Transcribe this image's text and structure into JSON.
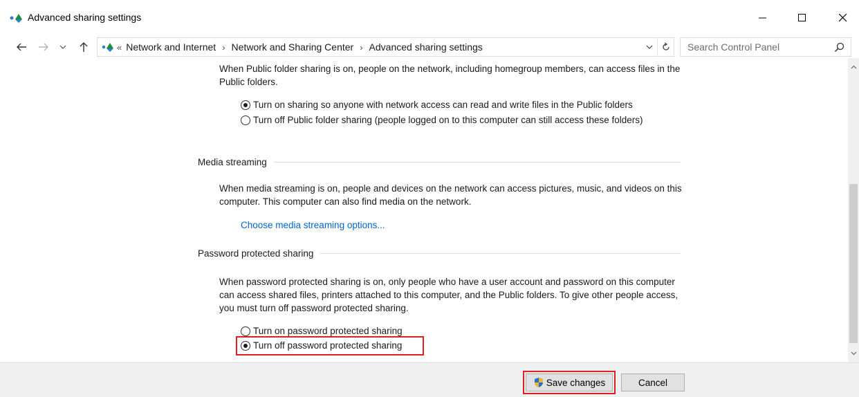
{
  "window": {
    "title": "Advanced sharing settings",
    "icon": "network-sharing-icon"
  },
  "address": {
    "overflow": "«",
    "crumbs": [
      "Network and Internet",
      "Network and Sharing Center",
      "Advanced sharing settings"
    ],
    "search_placeholder": "Search Control Panel"
  },
  "public_folder": {
    "description": "When Public folder sharing is on, people on the network, including homegroup members, can access files in the Public folders.",
    "option_on": "Turn on sharing so anyone with network access can read and write files in the Public folders",
    "option_off": "Turn off Public folder sharing (people logged on to this computer can still access these folders)",
    "selected": "on"
  },
  "media_streaming": {
    "heading": "Media streaming",
    "description": "When media streaming is on, people and devices on the network can access pictures, music, and videos on this computer. This computer can also find media on the network.",
    "link": "Choose media streaming options..."
  },
  "password_sharing": {
    "heading": "Password protected sharing",
    "description": "When password protected sharing is on, only people who have a user account and password on this computer can access shared files, printers attached to this computer, and the Public folders. To give other people access, you must turn off password protected sharing.",
    "option_on": "Turn on password protected sharing",
    "option_off": "Turn off password protected sharing",
    "selected": "off"
  },
  "footer": {
    "save_label": "Save changes",
    "cancel_label": "Cancel"
  },
  "colors": {
    "link": "#0066cc",
    "highlight": "#e02020",
    "footer_bg": "#f0f0f0"
  }
}
